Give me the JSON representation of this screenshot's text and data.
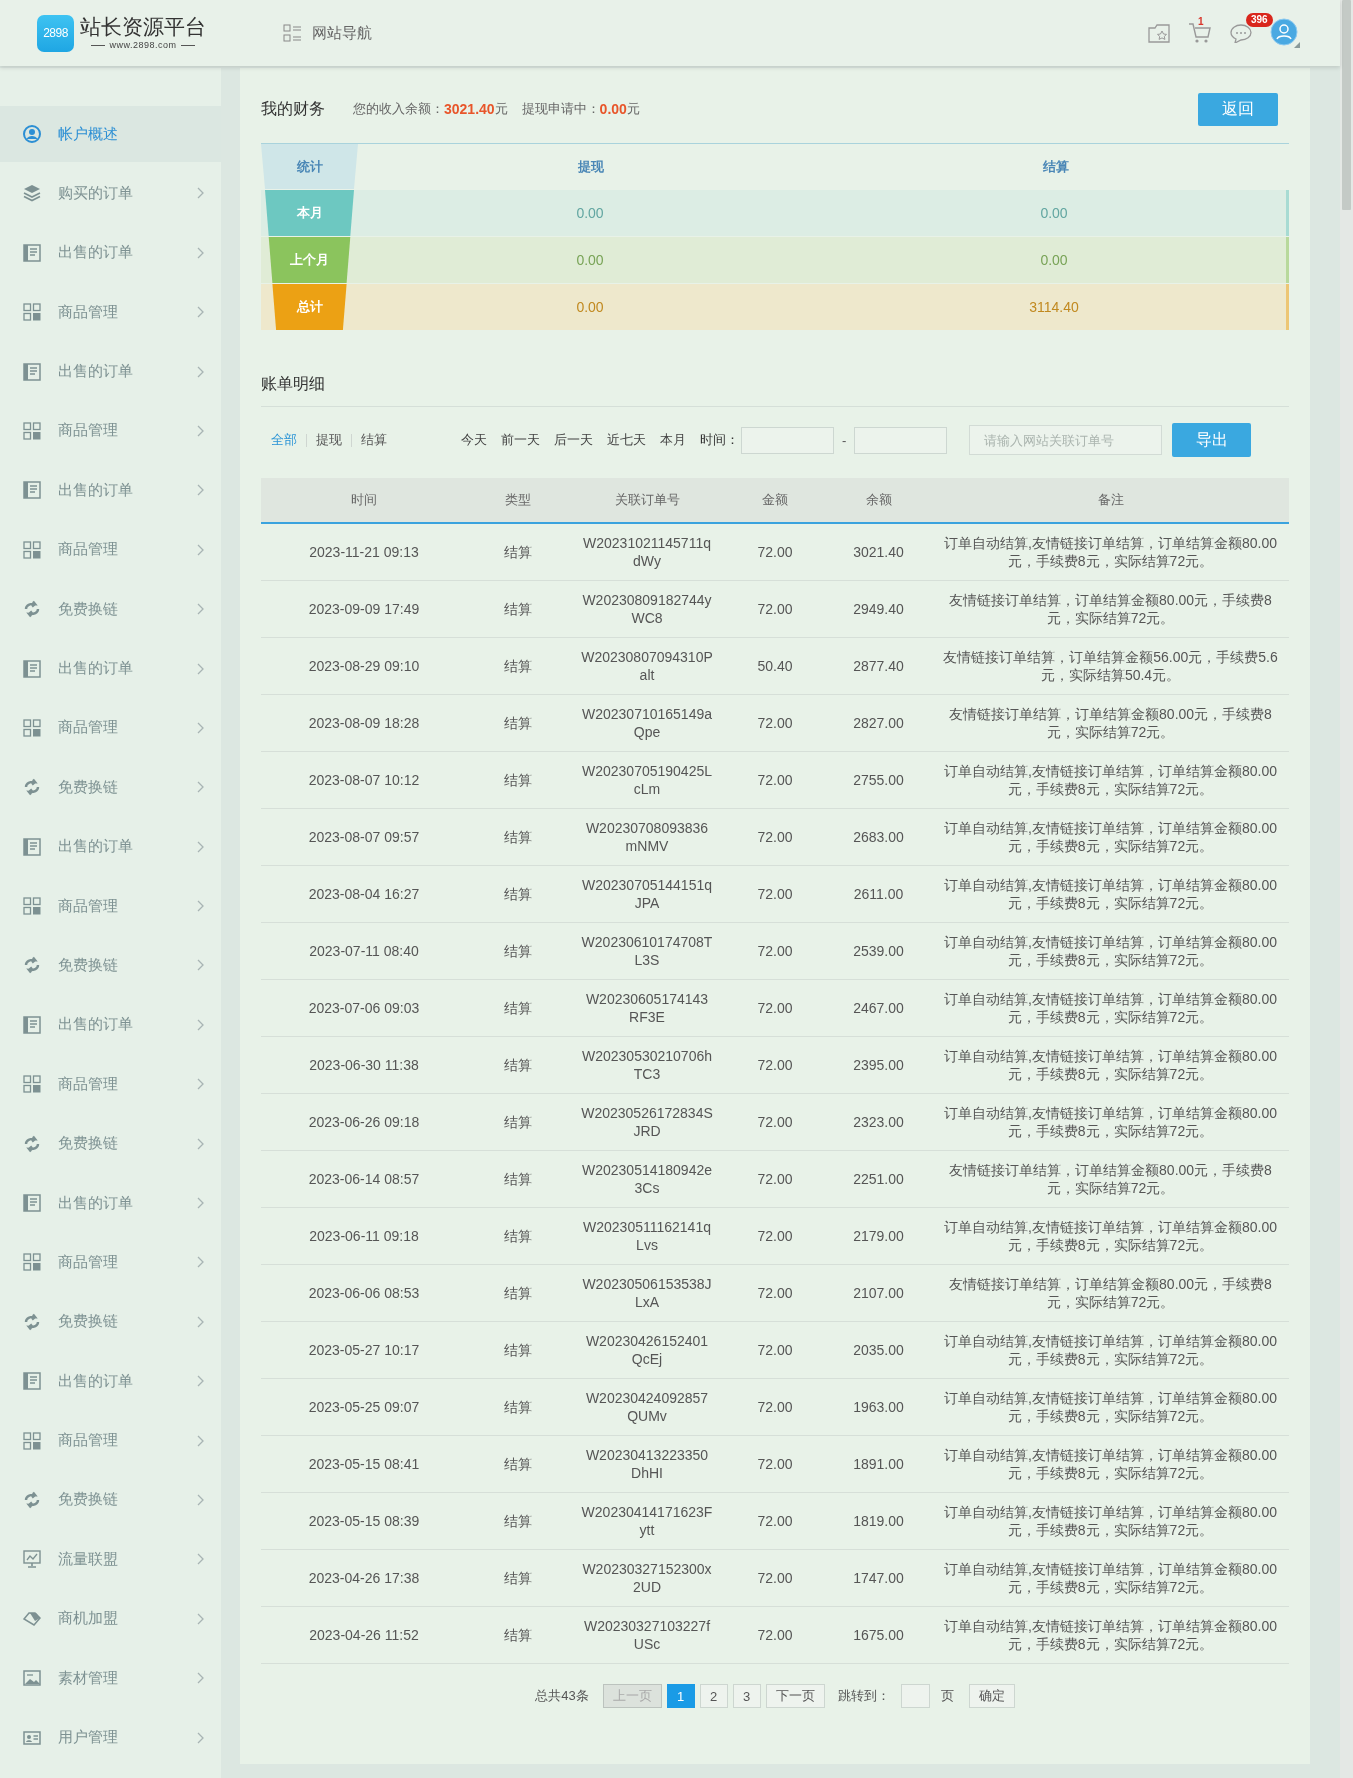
{
  "header": {
    "logo_badge": "2898",
    "logo_title": "站长资源平台",
    "logo_url": "www.2898.com",
    "nav_label": "网站导航",
    "cart_count": "1",
    "message_count": "396"
  },
  "sidebar": {
    "items": [
      {
        "label": "帐户概述",
        "kind": "account",
        "selected": true,
        "has_submenu": false
      },
      {
        "label": "购买的订单",
        "kind": "layers",
        "selected": false,
        "has_submenu": true
      },
      {
        "label": "出售的订单",
        "kind": "document",
        "selected": false,
        "has_submenu": true
      },
      {
        "label": "商品管理",
        "kind": "grid",
        "selected": false,
        "has_submenu": true
      },
      {
        "label": "出售的订单",
        "kind": "document",
        "selected": false,
        "has_submenu": true
      },
      {
        "label": "商品管理",
        "kind": "grid",
        "selected": false,
        "has_submenu": true
      },
      {
        "label": "出售的订单",
        "kind": "document",
        "selected": false,
        "has_submenu": true
      },
      {
        "label": "商品管理",
        "kind": "grid",
        "selected": false,
        "has_submenu": true
      },
      {
        "label": "免费换链",
        "kind": "swap",
        "selected": false,
        "has_submenu": true
      },
      {
        "label": "出售的订单",
        "kind": "document",
        "selected": false,
        "has_submenu": true
      },
      {
        "label": "商品管理",
        "kind": "grid",
        "selected": false,
        "has_submenu": true
      },
      {
        "label": "免费换链",
        "kind": "swap",
        "selected": false,
        "has_submenu": true
      },
      {
        "label": "出售的订单",
        "kind": "document",
        "selected": false,
        "has_submenu": true
      },
      {
        "label": "商品管理",
        "kind": "grid",
        "selected": false,
        "has_submenu": true
      },
      {
        "label": "免费换链",
        "kind": "swap",
        "selected": false,
        "has_submenu": true
      },
      {
        "label": "出售的订单",
        "kind": "document",
        "selected": false,
        "has_submenu": true
      },
      {
        "label": "商品管理",
        "kind": "grid",
        "selected": false,
        "has_submenu": true
      },
      {
        "label": "免费换链",
        "kind": "swap",
        "selected": false,
        "has_submenu": true
      },
      {
        "label": "出售的订单",
        "kind": "document",
        "selected": false,
        "has_submenu": true
      },
      {
        "label": "商品管理",
        "kind": "grid",
        "selected": false,
        "has_submenu": true
      },
      {
        "label": "免费换链",
        "kind": "swap",
        "selected": false,
        "has_submenu": true
      },
      {
        "label": "出售的订单",
        "kind": "document",
        "selected": false,
        "has_submenu": true
      },
      {
        "label": "商品管理",
        "kind": "grid",
        "selected": false,
        "has_submenu": true
      },
      {
        "label": "免费换链",
        "kind": "swap",
        "selected": false,
        "has_submenu": true
      },
      {
        "label": "流量联盟",
        "kind": "chart",
        "selected": false,
        "has_submenu": true
      },
      {
        "label": "商机加盟",
        "kind": "tag",
        "selected": false,
        "has_submenu": true
      },
      {
        "label": "素材管理",
        "kind": "image",
        "selected": false,
        "has_submenu": true
      },
      {
        "label": "用户管理",
        "kind": "card",
        "selected": false,
        "has_submenu": true
      }
    ]
  },
  "finance": {
    "title": "我的财务",
    "balance_label": "您的收入余额：",
    "balance_value": "3021.40",
    "balance_unit": "元",
    "pending_label": "提现申请中：",
    "pending_value": "0.00",
    "pending_unit": "元",
    "back_button": "返回",
    "summary": {
      "columns": [
        "统计",
        "提现",
        "结算"
      ],
      "rows": [
        {
          "label": "本月",
          "withdraw": "0.00",
          "settle": "0.00",
          "color": "#6dc8c1"
        },
        {
          "label": "上个月",
          "withdraw": "0.00",
          "settle": "0.00",
          "color": "#8bc45d"
        },
        {
          "label": "总计",
          "withdraw": "0.00",
          "settle": "3114.40",
          "color": "#eca114"
        }
      ]
    }
  },
  "bills": {
    "title": "账单明细",
    "tabs": [
      {
        "label": "全部",
        "selected": true
      },
      {
        "label": "提现",
        "selected": false
      },
      {
        "label": "结算",
        "selected": false
      }
    ],
    "quick_ranges": [
      "今天",
      "前一天",
      "后一天",
      "近七天",
      "本月"
    ],
    "time_label": "时间：",
    "time_separator": "-",
    "search": {
      "placeholder": "请输入网站关联订单号"
    },
    "export_button": "导出",
    "columns": [
      "时间",
      "类型",
      "关联订单号",
      "金额",
      "余额",
      "备注"
    ],
    "rows": [
      {
        "time": "2023-11-21 09:13",
        "type": "结算",
        "order_no": "W20231021145711qdWy",
        "amount": "72.00",
        "balance": "3021.40",
        "note": "订单自动结算,友情链接订单结算，订单结算金额80.00元，手续费8元，实际结算72元。"
      },
      {
        "time": "2023-09-09 17:49",
        "type": "结算",
        "order_no": "W20230809182744yWC8",
        "amount": "72.00",
        "balance": "2949.40",
        "note": "友情链接订单结算，订单结算金额80.00元，手续费8元，实际结算72元。"
      },
      {
        "time": "2023-08-29 09:10",
        "type": "结算",
        "order_no": "W20230807094310Palt",
        "amount": "50.40",
        "balance": "2877.40",
        "note": "友情链接订单结算，订单结算金额56.00元，手续费5.6元，实际结算50.4元。"
      },
      {
        "time": "2023-08-09 18:28",
        "type": "结算",
        "order_no": "W20230710165149aQpe",
        "amount": "72.00",
        "balance": "2827.00",
        "note": "友情链接订单结算，订单结算金额80.00元，手续费8元，实际结算72元。"
      },
      {
        "time": "2023-08-07 10:12",
        "type": "结算",
        "order_no": "W20230705190425LcLm",
        "amount": "72.00",
        "balance": "2755.00",
        "note": "订单自动结算,友情链接订单结算，订单结算金额80.00元，手续费8元，实际结算72元。"
      },
      {
        "time": "2023-08-07 09:57",
        "type": "结算",
        "order_no": "W20230708093836mNMV",
        "amount": "72.00",
        "balance": "2683.00",
        "note": "订单自动结算,友情链接订单结算，订单结算金额80.00元，手续费8元，实际结算72元。"
      },
      {
        "time": "2023-08-04 16:27",
        "type": "结算",
        "order_no": "W20230705144151qJPA",
        "amount": "72.00",
        "balance": "2611.00",
        "note": "订单自动结算,友情链接订单结算，订单结算金额80.00元，手续费8元，实际结算72元。"
      },
      {
        "time": "2023-07-11 08:40",
        "type": "结算",
        "order_no": "W20230610174708TL3S",
        "amount": "72.00",
        "balance": "2539.00",
        "note": "订单自动结算,友情链接订单结算，订单结算金额80.00元，手续费8元，实际结算72元。"
      },
      {
        "time": "2023-07-06 09:03",
        "type": "结算",
        "order_no": "W20230605174143RF3E",
        "amount": "72.00",
        "balance": "2467.00",
        "note": "订单自动结算,友情链接订单结算，订单结算金额80.00元，手续费8元，实际结算72元。"
      },
      {
        "time": "2023-06-30 11:38",
        "type": "结算",
        "order_no": "W20230530210706hTC3",
        "amount": "72.00",
        "balance": "2395.00",
        "note": "订单自动结算,友情链接订单结算，订单结算金额80.00元，手续费8元，实际结算72元。"
      },
      {
        "time": "2023-06-26 09:18",
        "type": "结算",
        "order_no": "W20230526172834SJRD",
        "amount": "72.00",
        "balance": "2323.00",
        "note": "订单自动结算,友情链接订单结算，订单结算金额80.00元，手续费8元，实际结算72元。"
      },
      {
        "time": "2023-06-14 08:57",
        "type": "结算",
        "order_no": "W20230514180942e3Cs",
        "amount": "72.00",
        "balance": "2251.00",
        "note": "友情链接订单结算，订单结算金额80.00元，手续费8元，实际结算72元。"
      },
      {
        "time": "2023-06-11 09:18",
        "type": "结算",
        "order_no": "W20230511162141qLvs",
        "amount": "72.00",
        "balance": "2179.00",
        "note": "订单自动结算,友情链接订单结算，订单结算金额80.00元，手续费8元，实际结算72元。"
      },
      {
        "time": "2023-06-06 08:53",
        "type": "结算",
        "order_no": "W20230506153538JLxA",
        "amount": "72.00",
        "balance": "2107.00",
        "note": "友情链接订单结算，订单结算金额80.00元，手续费8元，实际结算72元。"
      },
      {
        "time": "2023-05-27 10:17",
        "type": "结算",
        "order_no": "W20230426152401QcEj",
        "amount": "72.00",
        "balance": "2035.00",
        "note": "订单自动结算,友情链接订单结算，订单结算金额80.00元，手续费8元，实际结算72元。"
      },
      {
        "time": "2023-05-25 09:07",
        "type": "结算",
        "order_no": "W20230424092857QUMv",
        "amount": "72.00",
        "balance": "1963.00",
        "note": "订单自动结算,友情链接订单结算，订单结算金额80.00元，手续费8元，实际结算72元。"
      },
      {
        "time": "2023-05-15 08:41",
        "type": "结算",
        "order_no": "W20230413223350DhHI",
        "amount": "72.00",
        "balance": "1891.00",
        "note": "订单自动结算,友情链接订单结算，订单结算金额80.00元，手续费8元，实际结算72元。"
      },
      {
        "time": "2023-05-15 08:39",
        "type": "结算",
        "order_no": "W20230414171623Fytt",
        "amount": "72.00",
        "balance": "1819.00",
        "note": "订单自动结算,友情链接订单结算，订单结算金额80.00元，手续费8元，实际结算72元。"
      },
      {
        "time": "2023-04-26 17:38",
        "type": "结算",
        "order_no": "W20230327152300x2UD",
        "amount": "72.00",
        "balance": "1747.00",
        "note": "订单自动结算,友情链接订单结算，订单结算金额80.00元，手续费8元，实际结算72元。"
      },
      {
        "time": "2023-04-26 11:52",
        "type": "结算",
        "order_no": "W20230327103227fUSc",
        "amount": "72.00",
        "balance": "1675.00",
        "note": "订单自动结算,友情链接订单结算，订单结算金额80.00元，手续费8元，实际结算72元。"
      }
    ]
  },
  "pagination": {
    "total": "总共43条",
    "prev": {
      "label": "上一页",
      "disabled": true
    },
    "pages": [
      {
        "label": "1",
        "selected": true
      },
      {
        "label": "2",
        "selected": false
      },
      {
        "label": "3",
        "selected": false
      }
    ],
    "next": {
      "label": "下一页",
      "disabled": false
    },
    "jump_label": "跳转到：",
    "page_unit": "页",
    "confirm_button": "确定"
  }
}
